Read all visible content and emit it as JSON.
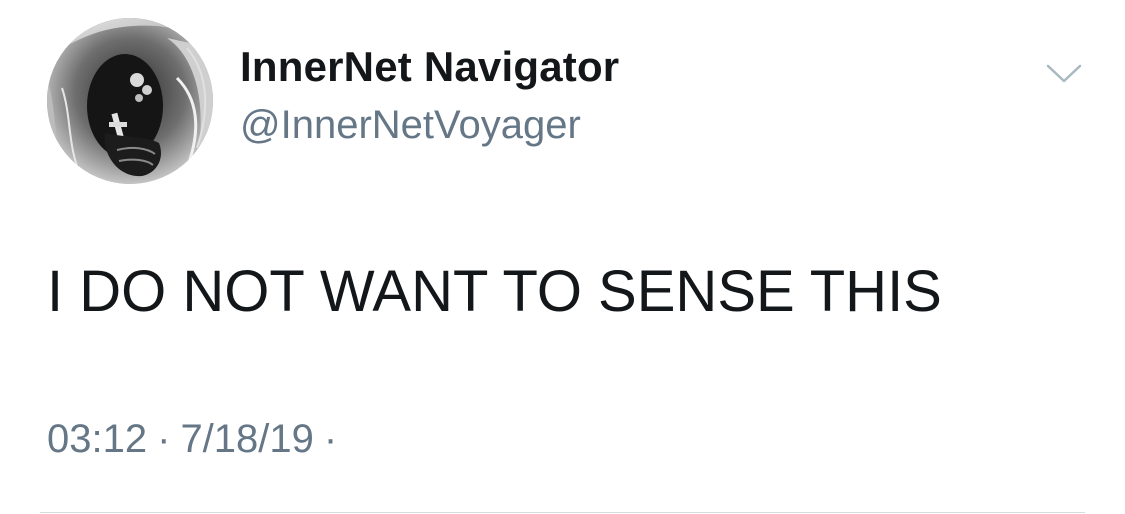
{
  "user": {
    "display_name": "InnerNet Navigator",
    "handle": "@InnerNetVoyager",
    "avatar_icon": "inverted-face-avatar"
  },
  "tweet": {
    "text": "I DO NOT WANT TO SENSE THIS",
    "time": "03:12",
    "separator": "·",
    "date": "7/18/19",
    "trailing_separator": "·"
  },
  "actions": {
    "more_icon": "chevron-down-icon"
  },
  "colors": {
    "name": "#14171a",
    "secondary": "#657786",
    "chevron": "#aab8c2",
    "divider": "#d6dbdf"
  }
}
